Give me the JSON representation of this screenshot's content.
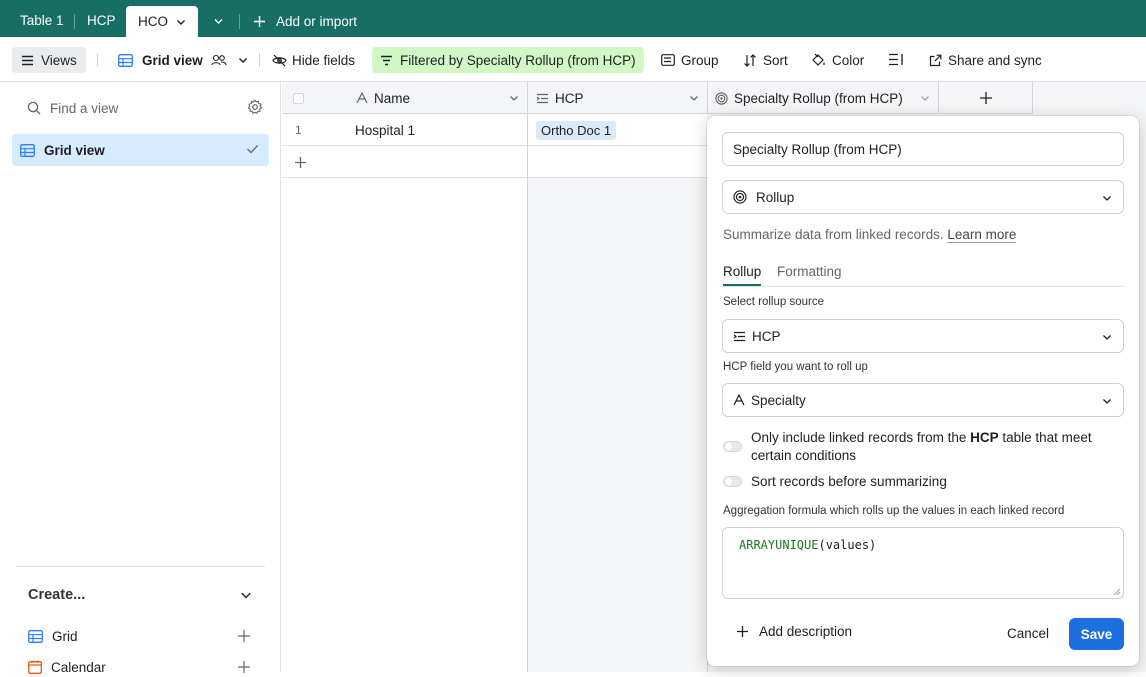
{
  "tabs": {
    "items": [
      {
        "label": "Table 1"
      },
      {
        "label": "HCP"
      },
      {
        "label": "HCO"
      }
    ],
    "add_import": "Add or import"
  },
  "toolbar": {
    "views": "Views",
    "grid_view": "Grid view",
    "hide_fields": "Hide fields",
    "filter": "Filtered by Specialty Rollup (from HCP)",
    "group": "Group",
    "sort": "Sort",
    "color": "Color",
    "share": "Share and sync"
  },
  "sidebar": {
    "find_placeholder": "Find a view",
    "view_item": "Grid view",
    "create_heading": "Create...",
    "create_items": [
      {
        "label": "Grid"
      },
      {
        "label": "Calendar"
      }
    ]
  },
  "grid": {
    "columns": [
      {
        "label": "Name"
      },
      {
        "label": "HCP"
      },
      {
        "label": "Specialty Rollup (from HCP)"
      }
    ],
    "rows": [
      {
        "num": "1",
        "name": "Hospital 1",
        "hcp": "Ortho Doc 1"
      }
    ]
  },
  "popup": {
    "field_name": "Specialty Rollup (from HCP)",
    "field_type": "Rollup",
    "description": "Summarize data from linked records.",
    "learn_more": "Learn more",
    "tab_rollup": "Rollup",
    "tab_formatting": "Formatting",
    "source_label": "Select rollup source",
    "source_value": "HCP",
    "field_label": "HCP field you want to roll up",
    "field_value": "Specialty",
    "option1_pre": "Only include linked records from the ",
    "option1_bold": "HCP",
    "option1_post": " table that meet certain conditions",
    "option2": "Sort records before summarizing",
    "formula_label": "Aggregation formula which rolls up the values in each linked record",
    "formula_fn": "ARRAYUNIQUE",
    "formula_args": "(values)",
    "add_description": "Add description",
    "cancel": "Cancel",
    "save": "Save"
  },
  "colors": {
    "header_bg": "#166e65",
    "filter_bg": "#d1f7c4",
    "selected_view_bg": "#d6ebfd",
    "save_bg": "#1d6fe0"
  }
}
